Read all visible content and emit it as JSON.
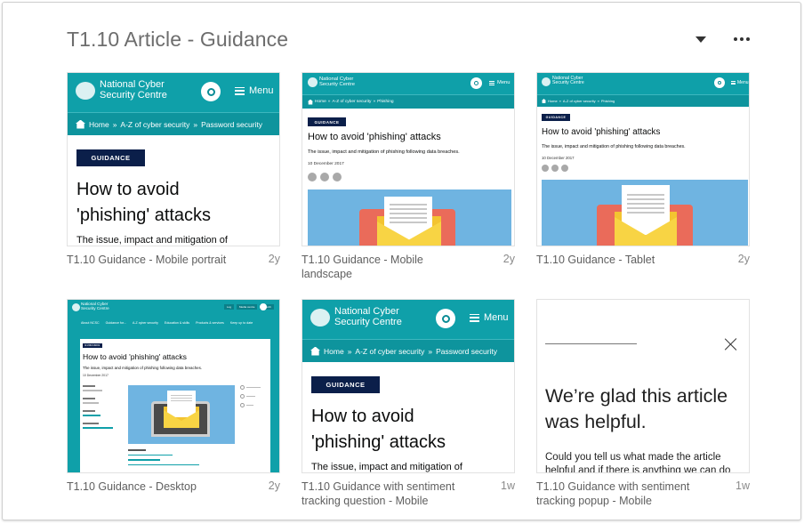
{
  "header": {
    "title": "T1.10 Article - Guidance"
  },
  "colors": {
    "teal": "#0fa0a9",
    "navy": "#0b1f4a",
    "hero_blue": "#6fb4e1",
    "laptop_red": "#ea6b5a",
    "envelope_yellow": "#f8d444"
  },
  "site": {
    "logo_line1": "National Cyber",
    "logo_line2": "Security Centre",
    "logo_sub": "a part of GCHQ",
    "menu": "Menu",
    "crumb_home": "Home",
    "crumb_sep": "»",
    "crumb_az": "A-Z of cyber security",
    "crumb_password": "Password security",
    "crumb_phishing": "Phishing",
    "badge": "GUIDANCE",
    "title_line1": "How to avoid",
    "title_line2": "'phishing' attacks",
    "title_full": "How to avoid 'phishing' attacks",
    "subtitle": "The issue, impact and mitigation of phishing following data breaches.",
    "subtitle_cut": "The issue, impact and mitigation of",
    "date": "10 December 2017",
    "desktop_nav": [
      "About NCSC",
      "Guidance for...",
      "A-Z cyber security",
      "Education & skills",
      "Products & services",
      "Keep up to date"
    ],
    "desktop_top_btns": [
      "Log",
      "Media centre",
      "Search"
    ]
  },
  "cards": [
    {
      "caption": "T1.10 Guidance - Mobile portrait",
      "age": "2y"
    },
    {
      "caption": "T1.10 Guidance - Mobile landscape",
      "age": "2y"
    },
    {
      "caption": "T1.10 Guidance - Tablet",
      "age": "2y"
    },
    {
      "caption": "T1.10 Guidance - Desktop",
      "age": "2y"
    },
    {
      "caption": "T1.10 Guidance with sentiment tracking question - Mobile",
      "age": "1w"
    },
    {
      "caption": "T1.10 Guidance with sentiment tracking popup - Mobile",
      "age": "1w"
    }
  ],
  "popup": {
    "heading": "We’re glad this article was helpful.",
    "body": "Could you tell us what made the article helpful and if there is anything we can do"
  }
}
